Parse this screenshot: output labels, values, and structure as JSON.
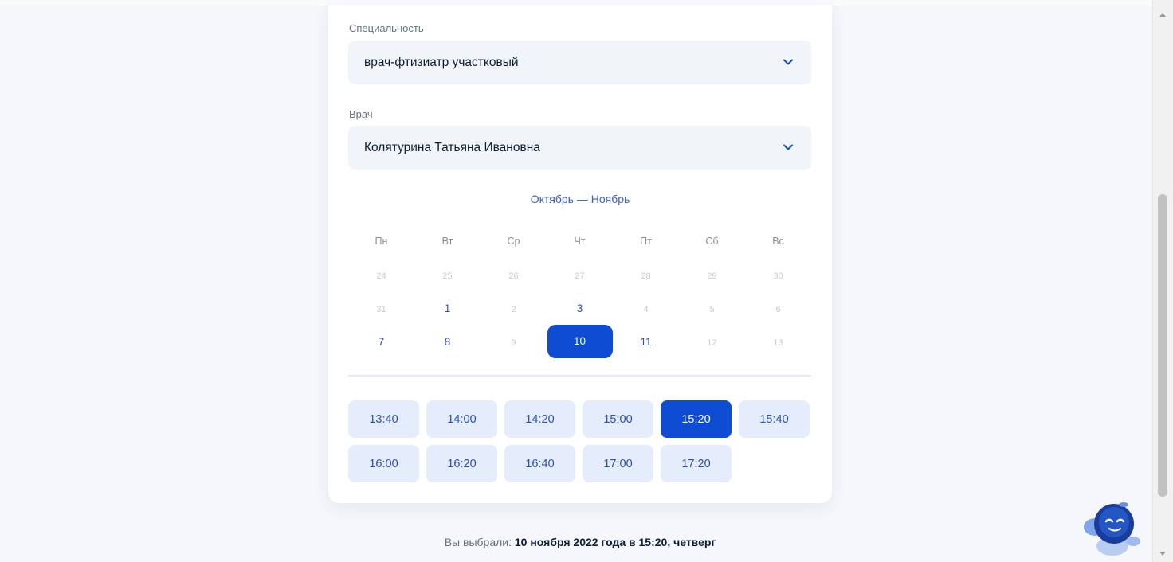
{
  "specialty": {
    "label": "Специальность",
    "value": "врач-фтизиатр участковый"
  },
  "doctor": {
    "label": "Врач",
    "value": "Колятурина Татьяна Ивановна"
  },
  "calendar": {
    "month_label": "Октябрь — Ноябрь",
    "weekdays": [
      "Пн",
      "Вт",
      "Ср",
      "Чт",
      "Пт",
      "Сб",
      "Вс"
    ],
    "weeks": [
      [
        {
          "d": "24",
          "s": "dim"
        },
        {
          "d": "25",
          "s": "dim"
        },
        {
          "d": "26",
          "s": "dim"
        },
        {
          "d": "27",
          "s": "dim"
        },
        {
          "d": "28",
          "s": "dim"
        },
        {
          "d": "29",
          "s": "dim"
        },
        {
          "d": "30",
          "s": "dim"
        }
      ],
      [
        {
          "d": "31",
          "s": "dim"
        },
        {
          "d": "1",
          "s": "avail"
        },
        {
          "d": "2",
          "s": "dim"
        },
        {
          "d": "3",
          "s": "avail"
        },
        {
          "d": "4",
          "s": "dim"
        },
        {
          "d": "5",
          "s": "dim"
        },
        {
          "d": "6",
          "s": "dim"
        }
      ],
      [
        {
          "d": "7",
          "s": "avail"
        },
        {
          "d": "8",
          "s": "avail"
        },
        {
          "d": "9",
          "s": "dim"
        },
        {
          "d": "10",
          "s": "selected"
        },
        {
          "d": "11",
          "s": "avail"
        },
        {
          "d": "12",
          "s": "dim"
        },
        {
          "d": "13",
          "s": "dim"
        }
      ]
    ]
  },
  "time_slots": [
    "13:40",
    "14:00",
    "14:20",
    "15:00",
    "15:20",
    "15:40",
    "16:00",
    "16:20",
    "16:40",
    "17:00",
    "17:20"
  ],
  "selected_slot": "15:20",
  "summary": {
    "prefix": "Вы выбрали:",
    "value": "10 ноября 2022 года в 15:20, четверг"
  },
  "colors": {
    "accent": "#0d4cd3",
    "slot_bg": "#e5ecfb",
    "link": "#3d5fc3"
  },
  "icons": {
    "dropdown": "chevron-down-icon",
    "assistant": "robot-assistant-icon"
  }
}
